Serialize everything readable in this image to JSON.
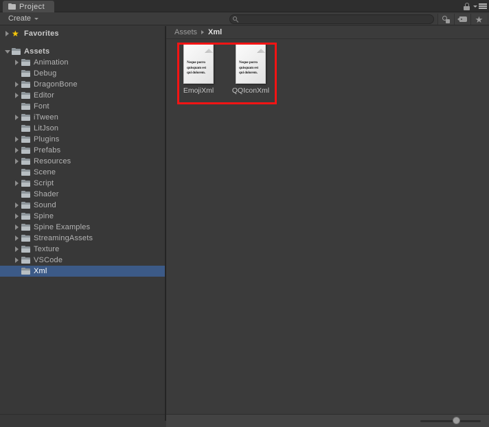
{
  "window": {
    "tab_label": "Project",
    "tab_icon": "folder-icon",
    "lock_icon": "lock-icon",
    "menu_icon": "hamburger-menu-icon"
  },
  "toolbar": {
    "create_label": "Create",
    "create_caret_icon": "chevron-down-icon",
    "search": {
      "value": "",
      "placeholder": "",
      "icon": "search-icon"
    },
    "filters": [
      {
        "name": "filter-by-type-button",
        "icon": "objects-icon"
      },
      {
        "name": "filter-by-label-button",
        "icon": "tag-icon"
      },
      {
        "name": "filter-favorites-button",
        "icon": "star-icon"
      }
    ]
  },
  "sidebar": {
    "favorites": {
      "label": "Favorites",
      "icon": "star-icon",
      "expanded": false
    },
    "tree": [
      {
        "label": "Assets",
        "depth": 0,
        "expanded": true,
        "expandable": true,
        "selected": false,
        "bold": true
      },
      {
        "label": "Animation",
        "depth": 1,
        "expanded": false,
        "expandable": true,
        "selected": false,
        "bold": false
      },
      {
        "label": "Debug",
        "depth": 1,
        "expanded": false,
        "expandable": false,
        "selected": false,
        "bold": false
      },
      {
        "label": "DragonBone",
        "depth": 1,
        "expanded": false,
        "expandable": true,
        "selected": false,
        "bold": false
      },
      {
        "label": "Editor",
        "depth": 1,
        "expanded": false,
        "expandable": true,
        "selected": false,
        "bold": false
      },
      {
        "label": "Font",
        "depth": 1,
        "expanded": false,
        "expandable": false,
        "selected": false,
        "bold": false
      },
      {
        "label": "iTween",
        "depth": 1,
        "expanded": false,
        "expandable": true,
        "selected": false,
        "bold": false
      },
      {
        "label": "LitJson",
        "depth": 1,
        "expanded": false,
        "expandable": false,
        "selected": false,
        "bold": false
      },
      {
        "label": "Plugins",
        "depth": 1,
        "expanded": false,
        "expandable": true,
        "selected": false,
        "bold": false
      },
      {
        "label": "Prefabs",
        "depth": 1,
        "expanded": false,
        "expandable": true,
        "selected": false,
        "bold": false
      },
      {
        "label": "Resources",
        "depth": 1,
        "expanded": false,
        "expandable": true,
        "selected": false,
        "bold": false
      },
      {
        "label": "Scene",
        "depth": 1,
        "expanded": false,
        "expandable": false,
        "selected": false,
        "bold": false
      },
      {
        "label": "Script",
        "depth": 1,
        "expanded": false,
        "expandable": true,
        "selected": false,
        "bold": false
      },
      {
        "label": "Shader",
        "depth": 1,
        "expanded": false,
        "expandable": false,
        "selected": false,
        "bold": false
      },
      {
        "label": "Sound",
        "depth": 1,
        "expanded": false,
        "expandable": true,
        "selected": false,
        "bold": false
      },
      {
        "label": "Spine",
        "depth": 1,
        "expanded": false,
        "expandable": true,
        "selected": false,
        "bold": false
      },
      {
        "label": "Spine Examples",
        "depth": 1,
        "expanded": false,
        "expandable": true,
        "selected": false,
        "bold": false
      },
      {
        "label": "StreamingAssets",
        "depth": 1,
        "expanded": false,
        "expandable": true,
        "selected": false,
        "bold": false
      },
      {
        "label": "Texture",
        "depth": 1,
        "expanded": false,
        "expandable": true,
        "selected": false,
        "bold": false
      },
      {
        "label": "VSCode",
        "depth": 1,
        "expanded": false,
        "expandable": true,
        "selected": false,
        "bold": false
      },
      {
        "label": "Xml",
        "depth": 1,
        "expanded": false,
        "expandable": false,
        "selected": true,
        "bold": false
      }
    ]
  },
  "content": {
    "breadcrumb": [
      {
        "label": "Assets",
        "active": false
      },
      {
        "label": "Xml",
        "active": true
      }
    ],
    "assets": [
      {
        "label": "EmojiXml",
        "preview_text": "Neque porro quisquam est qui dolorem.",
        "icon": "text-asset-icon"
      },
      {
        "label": "QQIconXml",
        "preview_text": "Neque porro quisquam est qui dolorem.",
        "icon": "text-asset-icon"
      }
    ],
    "highlight_color": "#f41414"
  },
  "status": {
    "zoom_slider_value": 53
  },
  "colors": {
    "selection_blue": "#3c5a87",
    "panel_left": "#383838",
    "panel_right": "#3b3b3b",
    "annotation_red": "#f41414"
  }
}
